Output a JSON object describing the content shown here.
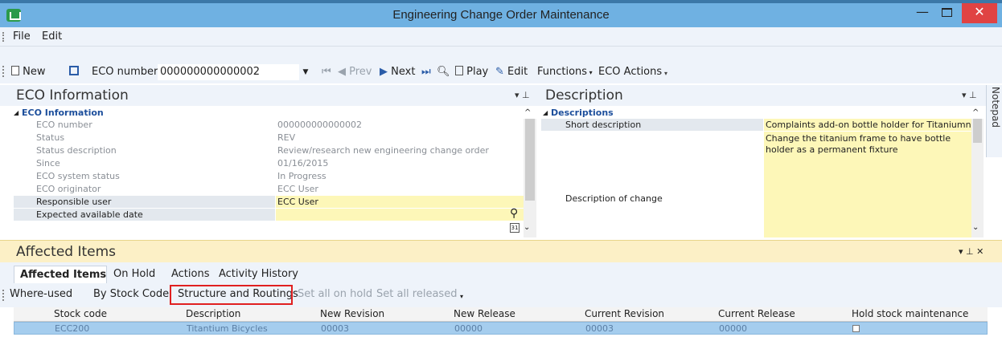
{
  "window": {
    "title": "Engineering Change Order Maintenance",
    "minimize": "—",
    "close": "✕"
  },
  "menu": [
    "File",
    "Edit"
  ],
  "toolbar": {
    "new_label": "New",
    "eco_number_label": "ECO number",
    "eco_number_value": "000000000000002",
    "prev_label": "Prev",
    "next_label": "Next",
    "play_label": "Play",
    "edit_label": "Edit",
    "functions_label": "Functions",
    "eco_actions_label": "ECO Actions"
  },
  "eco_info": {
    "panel_title": "ECO Information",
    "section_title": "ECO Information",
    "rows": [
      {
        "label": "ECO number",
        "value": "000000000000002",
        "editable": false
      },
      {
        "label": "Status",
        "value": "REV",
        "editable": false
      },
      {
        "label": "Status description",
        "value": "Review/research new engineering change order",
        "editable": false
      },
      {
        "label": "Since",
        "value": "01/16/2015",
        "editable": false
      },
      {
        "label": "ECO system status",
        "value": "In Progress",
        "editable": false
      },
      {
        "label": "ECO originator",
        "value": "ECC User",
        "editable": false
      },
      {
        "label": "Responsible user",
        "value": "ECC User",
        "editable": true
      },
      {
        "label": "Expected available date",
        "value": "",
        "editable": true
      }
    ]
  },
  "description": {
    "panel_title": "Description",
    "section_title": "Descriptions",
    "short_label": "Short description",
    "short_value": "Complaints add-on bottle holder for Titaniumn B",
    "change_label": "Description of change",
    "change_value": "Change the titanium frame to have bottle holder as a permanent fixture"
  },
  "notepad_label": "Notepad",
  "affected": {
    "panel_title": "Affected Items",
    "tabs": [
      "Affected Items",
      "On Hold",
      "Actions",
      "Activity History"
    ],
    "buttons": {
      "where_used": "Where-used",
      "by_stock_code": "By Stock Code",
      "structure": "Structure and Routings",
      "set_hold": "Set all on hold",
      "set_released": "Set all released"
    },
    "columns": [
      "Stock code",
      "Description",
      "New Revision",
      "New Release",
      "Current Revision",
      "Current Release",
      "Hold stock maintenance"
    ],
    "rows": [
      [
        "ECC200",
        "Titantium Bicycles",
        "00003",
        "00000",
        "00003",
        "00000"
      ]
    ]
  },
  "colors": {
    "accent": "#6fb1e2",
    "highlight_yellow": "#fdf7b8",
    "selected_row": "#a5cdee",
    "red_box": "#e02020"
  }
}
